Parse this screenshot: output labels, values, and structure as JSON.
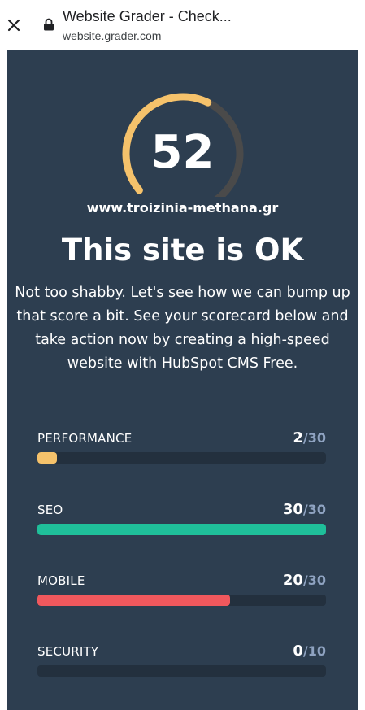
{
  "browser": {
    "tab_title": "Website Grader - Check...",
    "url": "website.grader.com"
  },
  "icons": {
    "close": "close-icon",
    "lock": "lock-icon"
  },
  "grader": {
    "score": "52",
    "score_fraction": 0.52,
    "site_url": "www.troizinia-methana.gr",
    "verdict": "This site is OK",
    "description": "Not too shabby. Let's see how we can bump up that score a bit. See your scorecard below and take action now by creating a high-speed website with HubSpot CMS Free.",
    "metrics": [
      {
        "label": "PERFORMANCE",
        "value": "2",
        "max": "/30",
        "color": "#f5c26b"
      },
      {
        "label": "SEO",
        "value": "30",
        "max": "/30",
        "color": "#1fbf9a"
      },
      {
        "label": "MOBILE",
        "value": "20",
        "max": "/30",
        "color": "#f0585d"
      },
      {
        "label": "SECURITY",
        "value": "0",
        "max": "/10",
        "color": "#f5c26b"
      }
    ]
  },
  "colors": {
    "panel": "#2d3e50",
    "gauge_fill": "#f5c26b",
    "gauge_track": "#4a4a4a",
    "bar_track": "#23303e"
  }
}
